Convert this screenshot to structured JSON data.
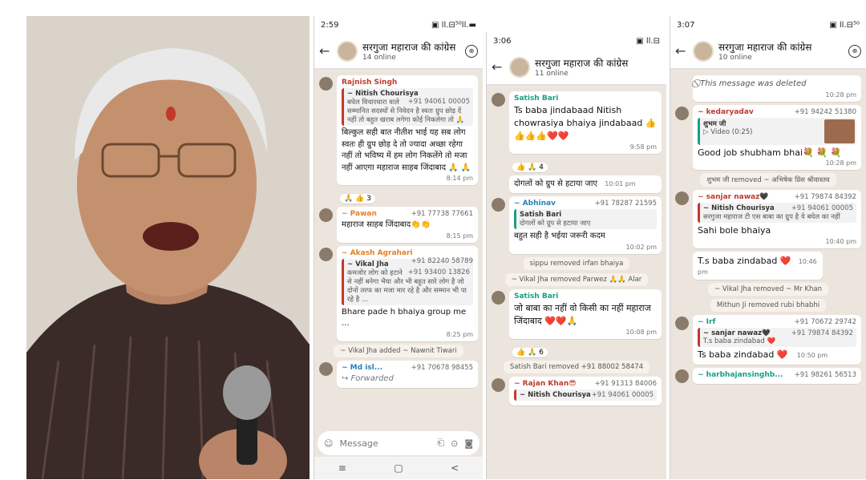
{
  "panel1": {
    "status_time": "2:59",
    "status_right": "▣ ll.⊟⁵⁰ll.▬",
    "title": "सरगुजा महाराज की कांग्रेस",
    "subtitle": "14 online",
    "messages": [
      {
        "sender": "Rajnish Singh",
        "sender_color": "#c0392b",
        "quote_sender": "~ Nitish Chourisya",
        "quote_phone": "+91 94061 00005",
        "quote_text": "बघेल विचारधारा वाले सम्मानित सदस्यों से निवेदन है स्वतः ग्रुप छोड़ दें नहीं तो बहुत खराब लगेगा कोई निकलेगा तो 🙏",
        "text": "बिल्कुल सही बात नीतीश भाई यह सब लोग स्वतः ही ग्रुप छोड़ दे तो ज्यादा अच्छा रहेगा नहीं तो भविष्य में हम लोग निकलेंगे तो मजा नहीं आएगा महाराज साहब जिंदाबाद 🙏 🙏",
        "time": "8:14 pm",
        "reaction": "🙏 👍 3"
      },
      {
        "sender": "~ Pawan",
        "sender_color": "#e67e22",
        "phone": "+91 77738 77661",
        "text": "महाराज साहब जिंदाबाद👏👏",
        "time": "8:15 pm"
      },
      {
        "sender": "~ Akash Agrahari",
        "sender_color": "#e67e22",
        "phone": "+91 82240 58789",
        "quote_sender": "~ Vikal Jha",
        "quote_phone": "+91 93400 13826",
        "quote_text": "कमजोर लोग को हटाने से नहीं बनेगा भैया और भी बहुत सारे लोग है जो दोनों तरफ का मजा मार रहे है और सम्मान भी पा रहे है ...",
        "text": "Bhare pade h bhaiya group me ...",
        "time": "8:25 pm"
      },
      {
        "sender": "~ Md isl...",
        "sender_color": "#2980b9",
        "phone": "+91 70678 98455",
        "text": "↪ Forwarded",
        "time": ""
      }
    ],
    "systems": [
      "~ Vikal Jha added ~ Nawnit Tiwari"
    ],
    "input_placeholder": "Message",
    "nav": [
      "≡",
      "▢",
      "<"
    ]
  },
  "panel2": {
    "status_time": "3:06",
    "status_right": "▣ ll.⊟",
    "title": "सरगुजा महाराज की कांग्रेस",
    "subtitle": "11 online",
    "messages": [
      {
        "sender": "Satish Bari",
        "sender_color": "#16a085",
        "text": "Ts baba jindabaad Nitish chowrasiya bhaiya jindabaad 👍👍👍👍❤️❤️",
        "time": "9:58 pm",
        "reaction": "👍 🙏 4"
      },
      {
        "sender": "",
        "text": "दोगलों को ग्रुप से हटाया जाए",
        "time": "10:01 pm"
      },
      {
        "sender": "~ Abhinav",
        "sender_color": "#2980b9",
        "phone": "+91 78287 21595",
        "quote_sender": "Satish Bari",
        "quote_phone": "",
        "quote_text": "दोगलों को ग्रुप से हटाया जाए",
        "text": "बहुत सही है भईया जरूरी कदम",
        "time": "10:02 pm"
      },
      {
        "sender": "Satish Bari",
        "sender_color": "#16a085",
        "text": "जो बाबा का नहीं वो किसी का नहीं महाराज जिंदाबाद ❤️❤️🙏",
        "time": "10:08 pm",
        "reaction": "👍 🙏 6"
      },
      {
        "sender": "~ Rajan Khan😎",
        "sender_color": "#c0392b",
        "phone": "+91 91313 84006",
        "quote_sender": "~ Nitish Chourisya",
        "quote_phone": "+91 94061 00005",
        "quote_text": "",
        "text": "",
        "time": ""
      }
    ],
    "systems": [
      "sippu removed irfan bhaiya",
      "~ Vikal Jha removed Parwez 🙏🙏 Alar",
      "Satish Bari removed +91 88002 58474"
    ]
  },
  "panel3": {
    "status_time": "3:07",
    "status_right": "▣ ll.⊟⁵⁰",
    "title": "सरगुजा महाराज की कांग्रेस",
    "subtitle": "10 online",
    "messages": [
      {
        "sender": "",
        "text": "⃠ This message was deleted",
        "time": "10:28 pm"
      },
      {
        "sender": "~ kedaryadav",
        "sender_color": "#c0392b",
        "phone": "+91 94242 51380",
        "quote_sender": "शुभम जी",
        "quote_phone": "",
        "quote_text": "▷ Video (0:25)",
        "text": "Good job shubham bhai💐 💐 💐",
        "time": "10:28 pm"
      },
      {
        "sender": "~ sanjar nawaz🖤",
        "sender_color": "#c0392b",
        "phone": "+91 79874 84392",
        "quote_sender": "~ Nitish Chourisya",
        "quote_phone": "+91 94061 00005",
        "quote_text": "सरगुजा महाराज टी एस बाबा का ग्रुप है ये बघेल का नहीं",
        "text": "Sahi bole bhaiya",
        "time": "10:40 pm"
      },
      {
        "sender": "",
        "text": "T.s baba zindabad ❤️",
        "time": "10:46 pm"
      },
      {
        "sender": "~ Irf",
        "sender_color": "#16a085",
        "phone": "+91 70672 29742",
        "quote_sender": "~ sanjar nawaz🖤",
        "quote_phone": "+91 79874 84392",
        "quote_text": "T.s baba zindabad ❤️",
        "text": "Ts baba zindabad ❤️",
        "time": "10:50 pm"
      },
      {
        "sender": "~ harbhajansinghb...",
        "sender_color": "#16a085",
        "phone": "+91 98261 56513",
        "text": "",
        "time": ""
      }
    ],
    "systems": [
      "शुभम जी removed ~ अभिषेक प्रिंस श्रीवास्तव",
      "~ Vikal Jha removed ~ Mr Khan",
      "Mithun Ji removed rubi bhabhi"
    ]
  }
}
